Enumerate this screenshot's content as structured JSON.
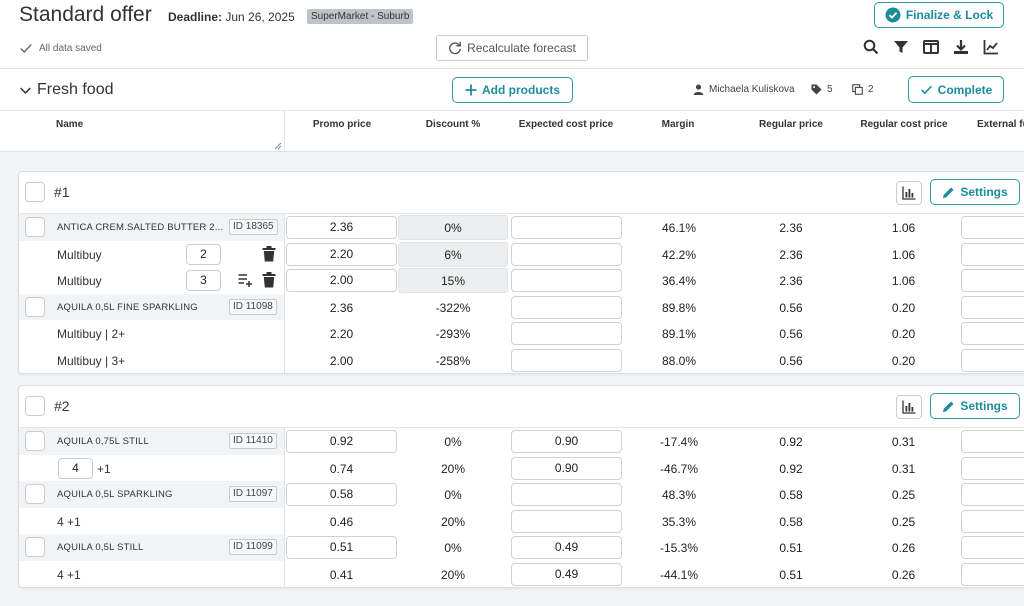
{
  "header": {
    "title": "Standard offer",
    "deadline_label": "Deadline:",
    "deadline_value": "Jun 26, 2025",
    "store": "SuperMarket - Suburb",
    "saved_status": "All data saved",
    "recalc_label": "Recalculate forecast",
    "finalize_label": "Finalize & Lock",
    "toolbar_icons": [
      "search-icon",
      "filter-icon",
      "columns-icon",
      "download-icon",
      "chart-line-icon"
    ]
  },
  "section": {
    "title": "Fresh food",
    "add_products_label": "Add products",
    "owner": "Michaela Kuliskova",
    "tag_count": "5",
    "copy_count": "2",
    "complete_label": "Complete"
  },
  "columns": [
    "Name",
    "Promo price",
    "Discount %",
    "Expected cost price",
    "Margin",
    "Regular price",
    "Regular cost price",
    "External fu"
  ],
  "settings_label": "Settings",
  "groups": [
    {
      "number": "#1",
      "rows": [
        {
          "kind": "product",
          "name": "ANTICA CREM.SALTED BUTTER 2...",
          "id": "ID 18365",
          "promo": "2.36",
          "promo_input": true,
          "discount": "0%",
          "discount_shaded": true,
          "cost": "",
          "margin": "46.1%",
          "regular": "2.36",
          "regular_cost": "1.06"
        },
        {
          "kind": "multibuy",
          "label": "Multibuy",
          "qty": "2",
          "promo": "2.20",
          "promo_input": true,
          "discount": "6%",
          "discount_shaded": true,
          "cost": "",
          "margin": "42.2%",
          "regular": "2.36",
          "regular_cost": "1.06"
        },
        {
          "kind": "multibuy",
          "label": "Multibuy",
          "qty": "3",
          "promo": "2.00",
          "promo_input": true,
          "discount": "15%",
          "discount_shaded": true,
          "cost": "",
          "margin": "36.4%",
          "regular": "2.36",
          "regular_cost": "1.06"
        },
        {
          "kind": "product",
          "name": "AQUILA 0,5L FINE SPARKLING",
          "id": "ID 11098",
          "promo": "2.36",
          "promo_input": false,
          "discount": "-322%",
          "cost": "",
          "margin": "89.8%",
          "regular": "0.56",
          "regular_cost": "0.20"
        },
        {
          "kind": "label",
          "label": "Multibuy | 2+",
          "promo": "2.20",
          "promo_input": false,
          "discount": "-293%",
          "cost": "",
          "margin": "89.1%",
          "regular": "0.56",
          "regular_cost": "0.20"
        },
        {
          "kind": "label",
          "label": "Multibuy | 3+",
          "promo": "2.00",
          "promo_input": false,
          "discount": "-258%",
          "cost": "",
          "margin": "88.0%",
          "regular": "0.56",
          "regular_cost": "0.20"
        }
      ]
    },
    {
      "number": "#2",
      "rows": [
        {
          "kind": "product",
          "name": "AQUILA 0,75L STILL",
          "id": "ID 11410",
          "promo": "0.92",
          "promo_input": true,
          "discount": "0%",
          "cost": "0.90",
          "margin": "-17.4%",
          "regular": "0.92",
          "regular_cost": "0.31"
        },
        {
          "kind": "qtyplus",
          "qty": "4",
          "suffix": "+1",
          "promo": "0.74",
          "promo_input": false,
          "discount": "20%",
          "cost": "0.90",
          "margin": "-46.7%",
          "regular": "0.92",
          "regular_cost": "0.31"
        },
        {
          "kind": "product",
          "name": "AQUILA 0,5L SPARKLING",
          "id": "ID 11097",
          "promo": "0.58",
          "promo_input": true,
          "discount": "0%",
          "cost": "",
          "margin": "48.3%",
          "regular": "0.58",
          "regular_cost": "0.25"
        },
        {
          "kind": "label",
          "label": "4 +1",
          "promo": "0.46",
          "promo_input": false,
          "discount": "20%",
          "cost": "",
          "margin": "35.3%",
          "regular": "0.58",
          "regular_cost": "0.25"
        },
        {
          "kind": "product",
          "name": "AQUILA 0,5L STILL",
          "id": "ID 11099",
          "promo": "0.51",
          "promo_input": true,
          "discount": "0%",
          "cost": "0.49",
          "margin": "-15.3%",
          "regular": "0.51",
          "regular_cost": "0.26"
        },
        {
          "kind": "label",
          "label": "4 +1",
          "promo": "0.41",
          "promo_input": false,
          "discount": "20%",
          "cost": "0.49",
          "margin": "-44.1%",
          "regular": "0.51",
          "regular_cost": "0.26"
        }
      ]
    }
  ]
}
